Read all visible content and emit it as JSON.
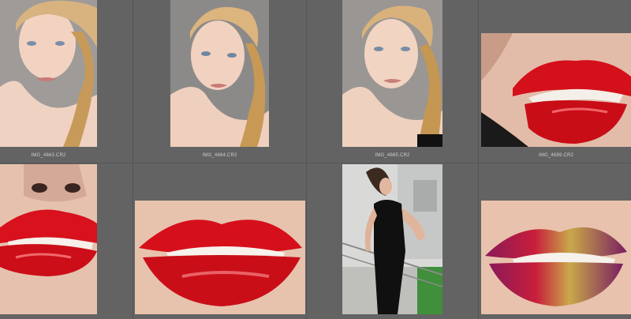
{
  "filmstrip": {
    "row1": [
      {
        "filename": "IMG_4663.CR2",
        "subject": "portrait-braid-front"
      },
      {
        "filename": "IMG_4664.CR2",
        "subject": "portrait-braid-turn"
      },
      {
        "filename": "IMG_4665.CR2",
        "subject": "portrait-braid-front-2"
      },
      {
        "filename": "IMG_4689.CR2",
        "subject": "red-lips-side"
      }
    ],
    "row2": [
      {
        "filename": "",
        "subject": "red-lips-nose"
      },
      {
        "filename": "",
        "subject": "red-lips-closeup"
      },
      {
        "filename": "",
        "subject": "woman-black-dress-balcony"
      },
      {
        "filename": "",
        "subject": "gold-purple-lips"
      }
    ]
  },
  "colors": {
    "background": "#636363",
    "cell_divider": "#555555",
    "lip_red": "#d4101b",
    "caption_text": "#cfcfcf"
  }
}
